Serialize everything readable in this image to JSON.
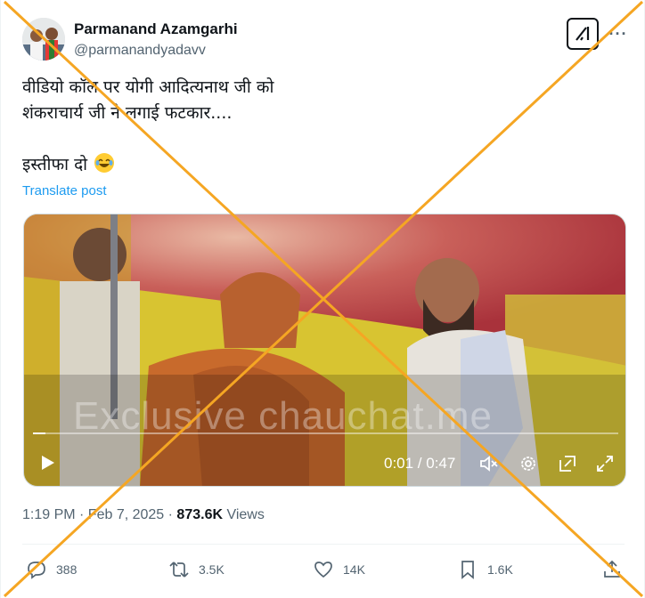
{
  "author": {
    "name": "Parmanand Azamgarhi",
    "handle": "@parmanandyadavv"
  },
  "post": {
    "lines": [
      "वीडियो कॉल पर योगी आदित्यनाथ जी को",
      "शंकराचार्य जी ने लगाई फटकार....",
      "इस्तीफा दो"
    ],
    "emoji": "face-with-tears-of-joy",
    "translate_label": "Translate post"
  },
  "video": {
    "watermark": "Exclusive chauchat.me",
    "time_display": "0:01 / 0:47",
    "progress_fraction": 0.021
  },
  "meta": {
    "timestamp": "1:19 PM · Feb 7, 2025 · ",
    "views_count": "873.6K",
    "views_label": " Views"
  },
  "actions": {
    "replies": "388",
    "reposts": "3.5K",
    "likes": "14K",
    "bookmarks": "1.6K"
  },
  "colors": {
    "accent": "#1d9bf0",
    "secondary_text": "#536471",
    "cross_overlay": "#f5a623"
  },
  "icons": [
    "grok-icon",
    "more-icon",
    "play-icon",
    "mute-icon",
    "settings-icon",
    "pip-icon",
    "fullscreen-icon",
    "reply-icon",
    "repost-icon",
    "like-icon",
    "bookmark-icon",
    "share-icon"
  ]
}
